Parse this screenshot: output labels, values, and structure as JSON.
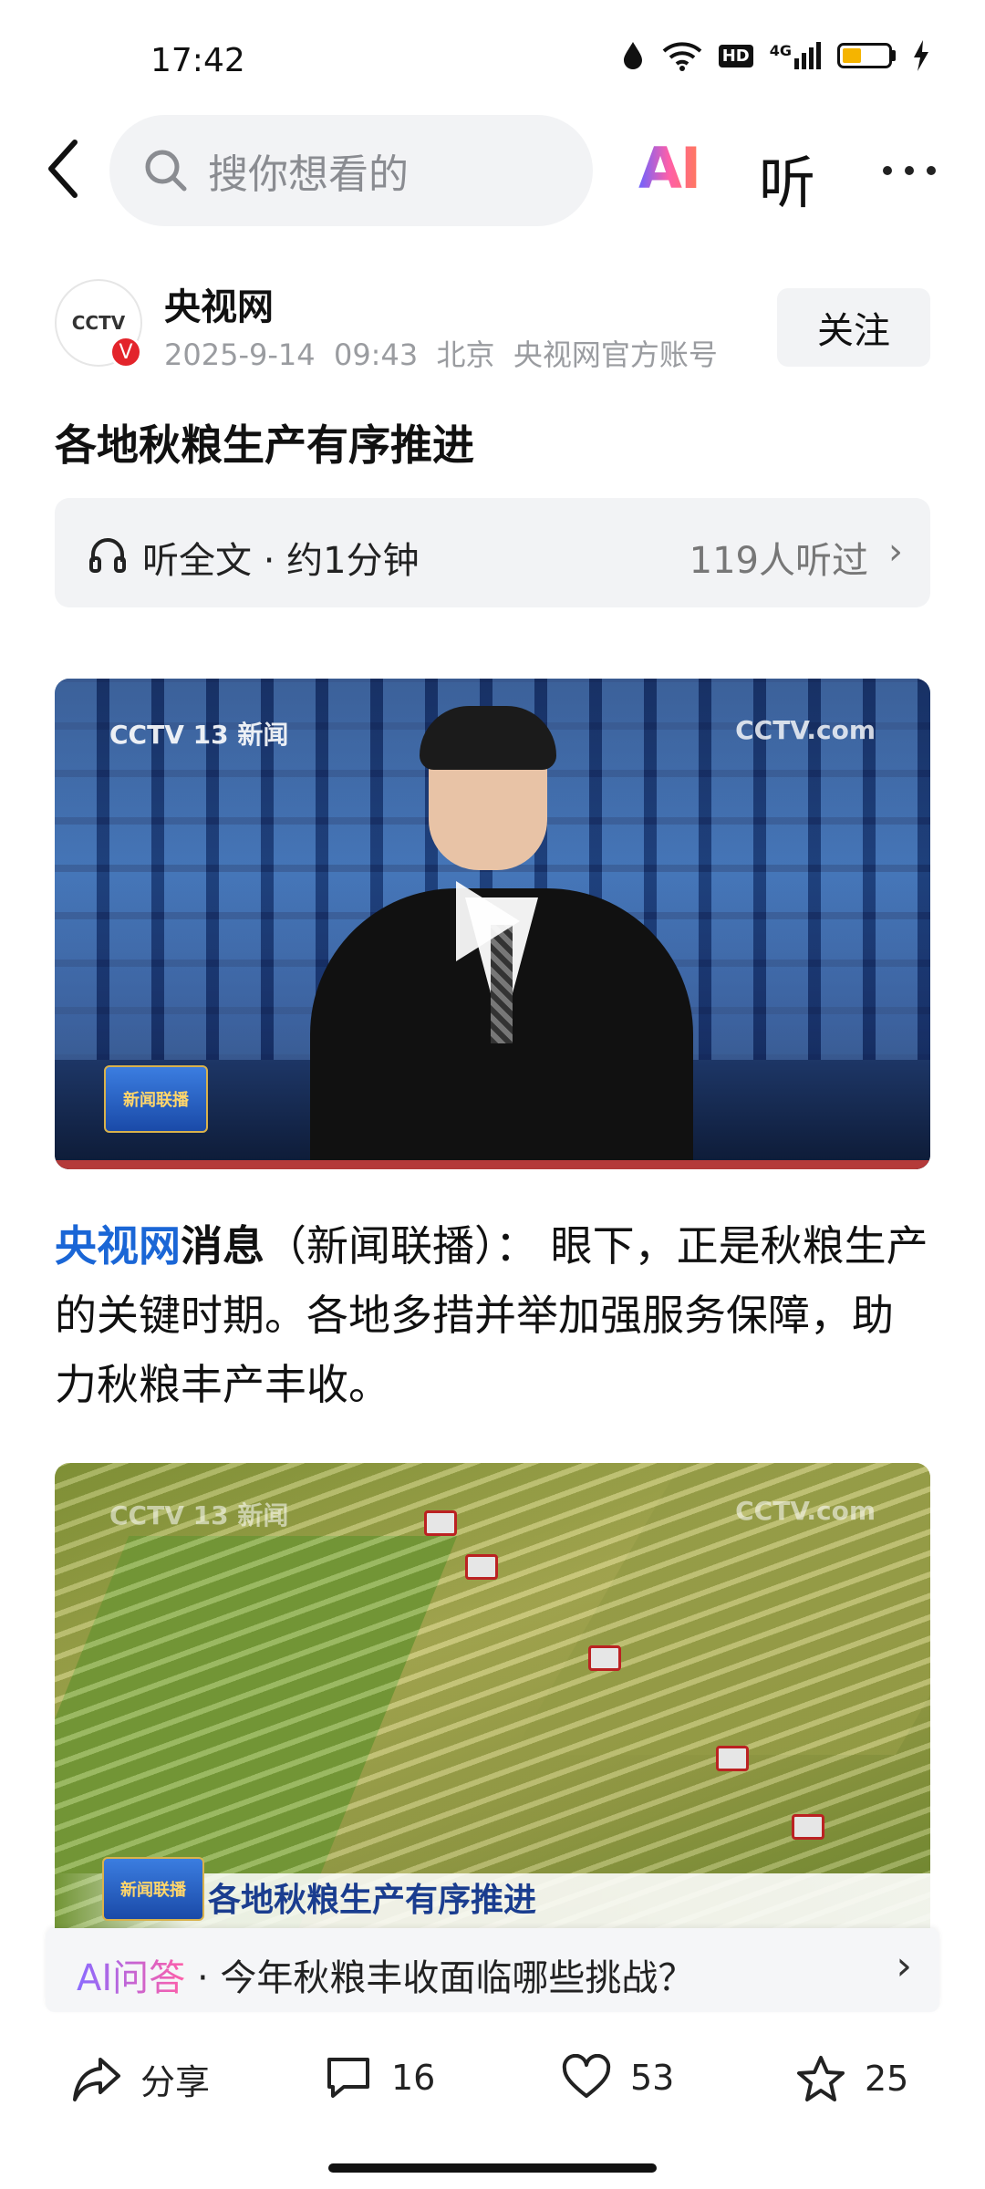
{
  "status_bar": {
    "time": "17:42",
    "network": "4G",
    "hd": "HD"
  },
  "header": {
    "search_placeholder": "搜你想看的",
    "ai_label": "AI",
    "listen_label": "听"
  },
  "author": {
    "avatar_text": "CCTV",
    "name": "央视网",
    "date": "2025-9-14",
    "time": "09:43",
    "location": "北京",
    "account_type": "央视网官方账号",
    "follow_label": "关注"
  },
  "article": {
    "title": "各地秋粮生产有序推进",
    "audio": {
      "label": "听全文 · 约1分钟",
      "listeners": "119人听过"
    },
    "video1": {
      "logo_left": "CCTV 13 新闻",
      "logo_right": "CCTV.com",
      "program_badge": "新闻联播"
    },
    "paragraph": {
      "source": "央视网",
      "lead": "消息",
      "body": "（新闻联播）： 眼下，正是秋粮生产的关键时期。各地多措并举加强服务保障，助力秋粮丰产丰收。"
    },
    "video2": {
      "logo_left": "CCTV 13 新闻",
      "logo_right": "CCTV.com",
      "program_badge": "新闻联播",
      "caption": "各地秋粮生产有序推进"
    }
  },
  "ai_qa": {
    "tag": "AI问答",
    "question": " · 今年秋粮丰收面临哪些挑战？"
  },
  "bottom_bar": {
    "share_label": "分享",
    "comments": "16",
    "likes": "53",
    "favorites": "25"
  }
}
